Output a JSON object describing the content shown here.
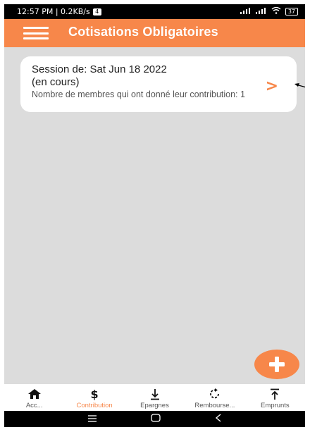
{
  "status_bar": {
    "time_speed": "12:57 PM | 0.2KB/s",
    "notification_badge": "4",
    "battery": "37"
  },
  "app_bar": {
    "title": "Cotisations Obligatoires"
  },
  "session_card": {
    "title_line1": "Session de: Sat Jun 18 2022",
    "title_line2": "(en cours)",
    "subtitle": "Nombre de membres qui ont donné leur contribution: 1"
  },
  "bottom_nav": {
    "items": [
      {
        "label": "Acc...",
        "icon": "home-icon"
      },
      {
        "label": "Contribution",
        "icon": "dollar-icon"
      },
      {
        "label": "Epargnes",
        "icon": "download-icon"
      },
      {
        "label": "Rembourse...",
        "icon": "refresh-icon"
      },
      {
        "label": "Emprunts",
        "icon": "upload-icon"
      }
    ],
    "active_index": 1
  },
  "colors": {
    "accent": "#f7874a",
    "background": "#dcdcdc"
  }
}
